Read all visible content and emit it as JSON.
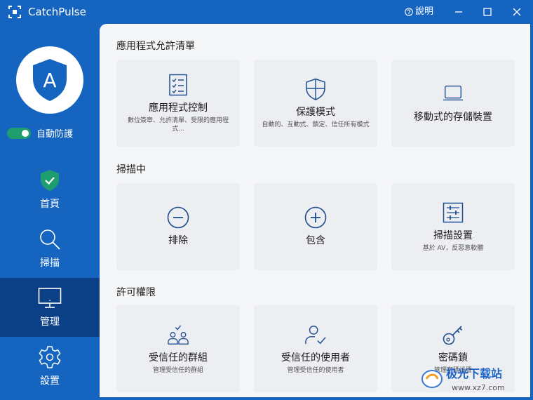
{
  "window": {
    "title": "CatchPulse",
    "help_label": "說明"
  },
  "sidebar": {
    "avatar_letter": "A",
    "auto_protect_label": "自動防護",
    "items": [
      {
        "label": "首頁",
        "icon": "shield-check-icon"
      },
      {
        "label": "掃描",
        "icon": "magnifier-icon"
      },
      {
        "label": "管理",
        "icon": "monitor-icon",
        "active": true
      },
      {
        "label": "設置",
        "icon": "gear-icon"
      }
    ]
  },
  "sections": [
    {
      "title": "應用程式允許清單",
      "cards": [
        {
          "title": "應用程式控制",
          "desc": "數位簽章、允許清單、受限的應用程式...",
          "icon": "checklist-icon"
        },
        {
          "title": "保護模式",
          "desc": "自動的、互動式、鎖定、信任所有模式",
          "icon": "shield-quadrant-icon"
        },
        {
          "title": "移動式的存儲裝置",
          "desc": "",
          "icon": "laptop-icon"
        }
      ]
    },
    {
      "title": "掃描中",
      "cards": [
        {
          "title": "排除",
          "desc": "",
          "icon": "minus-circle-icon"
        },
        {
          "title": "包含",
          "desc": "",
          "icon": "plus-circle-icon"
        },
        {
          "title": "掃描設置",
          "desc": "基於 AV，反惡意軟體",
          "icon": "sliders-icon"
        }
      ]
    },
    {
      "title": "許可權限",
      "cards": [
        {
          "title": "受信任的群組",
          "desc": "管理受信任的群組",
          "icon": "group-check-icon"
        },
        {
          "title": "受信任的使用者",
          "desc": "管理受信任的使用者",
          "icon": "user-check-icon"
        },
        {
          "title": "密碼鎖",
          "desc": "管理密碼設置",
          "icon": "key-icon"
        }
      ]
    }
  ],
  "watermark": {
    "line1": "极光下载站",
    "line2": "www.xz7.com"
  },
  "colors": {
    "sidebar": "#1565c0",
    "active_nav": "#0b3f86",
    "toggle_on": "#1e9e6e",
    "card_bg": "#eceef2",
    "icon_blue": "#1f4f8f"
  }
}
